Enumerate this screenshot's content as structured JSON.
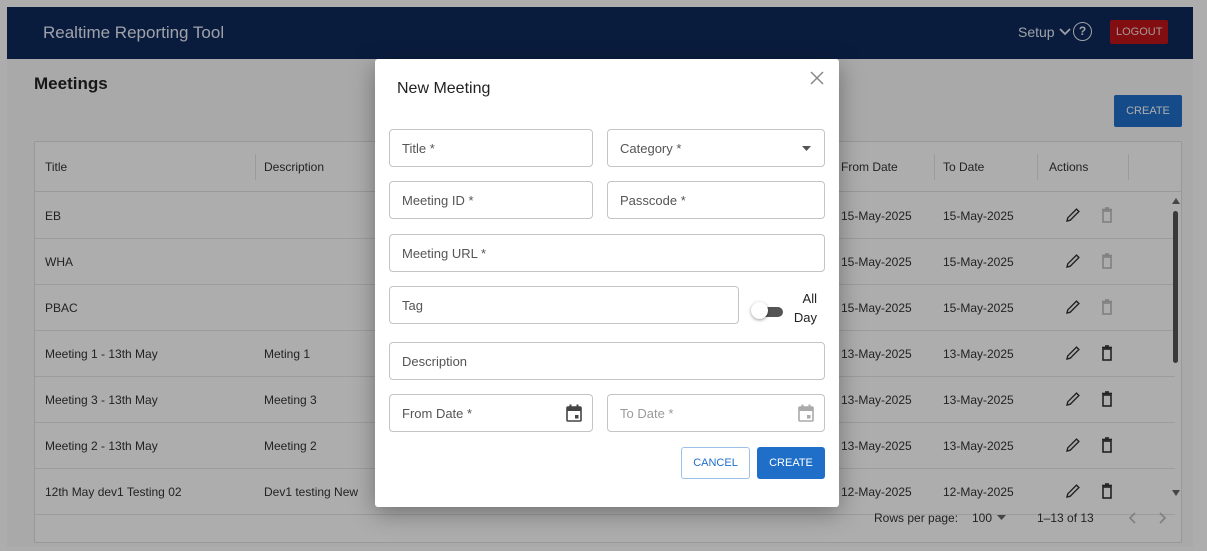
{
  "header": {
    "app_title": "Realtime Reporting Tool",
    "setup_label": "Setup",
    "help_label": "?",
    "logout_label": "LOGOUT"
  },
  "page": {
    "title": "Meetings",
    "create_label": "CREATE"
  },
  "table": {
    "columns": [
      "Title",
      "Description",
      "From Date",
      "To Date",
      "Actions"
    ],
    "rows": [
      {
        "title": "EB",
        "description": "",
        "from": "15-May-2025",
        "to": "15-May-2025",
        "delete_enabled": false
      },
      {
        "title": "WHA",
        "description": "",
        "from": "15-May-2025",
        "to": "15-May-2025",
        "delete_enabled": false
      },
      {
        "title": "PBAC",
        "description": "",
        "from": "15-May-2025",
        "to": "15-May-2025",
        "delete_enabled": false
      },
      {
        "title": "Meeting 1 - 13th May",
        "description": "Meting 1",
        "from": "13-May-2025",
        "to": "13-May-2025",
        "delete_enabled": true
      },
      {
        "title": "Meeting 3 - 13th May",
        "description": "Meeting 3",
        "from": "13-May-2025",
        "to": "13-May-2025",
        "delete_enabled": true
      },
      {
        "title": "Meeting 2 - 13th May",
        "description": "Meeting 2",
        "from": "13-May-2025",
        "to": "13-May-2025",
        "delete_enabled": true
      },
      {
        "title": "12th May dev1 Testing 02",
        "description": "Dev1 testing New",
        "from": "12-May-2025",
        "to": "12-May-2025",
        "delete_enabled": true
      }
    ],
    "footer": {
      "rows_per_page_label": "Rows per page:",
      "rows_per_page_value": "100",
      "range": "1–13 of 13"
    }
  },
  "modal": {
    "title": "New Meeting",
    "fields": {
      "title": "Title *",
      "category": "Category *",
      "meeting_id": "Meeting ID *",
      "passcode": "Passcode *",
      "meeting_url": "Meeting URL *",
      "tag": "Tag",
      "all_day_line1": "All",
      "all_day_line2": "Day",
      "description": "Description",
      "from_date": "From Date *",
      "to_date": "To Date *"
    },
    "cancel_label": "CANCEL",
    "create_label": "CREATE"
  },
  "colors": {
    "header_bg": "#0f2a5c",
    "primary": "#1f6fc9",
    "logout": "#c0161b"
  }
}
